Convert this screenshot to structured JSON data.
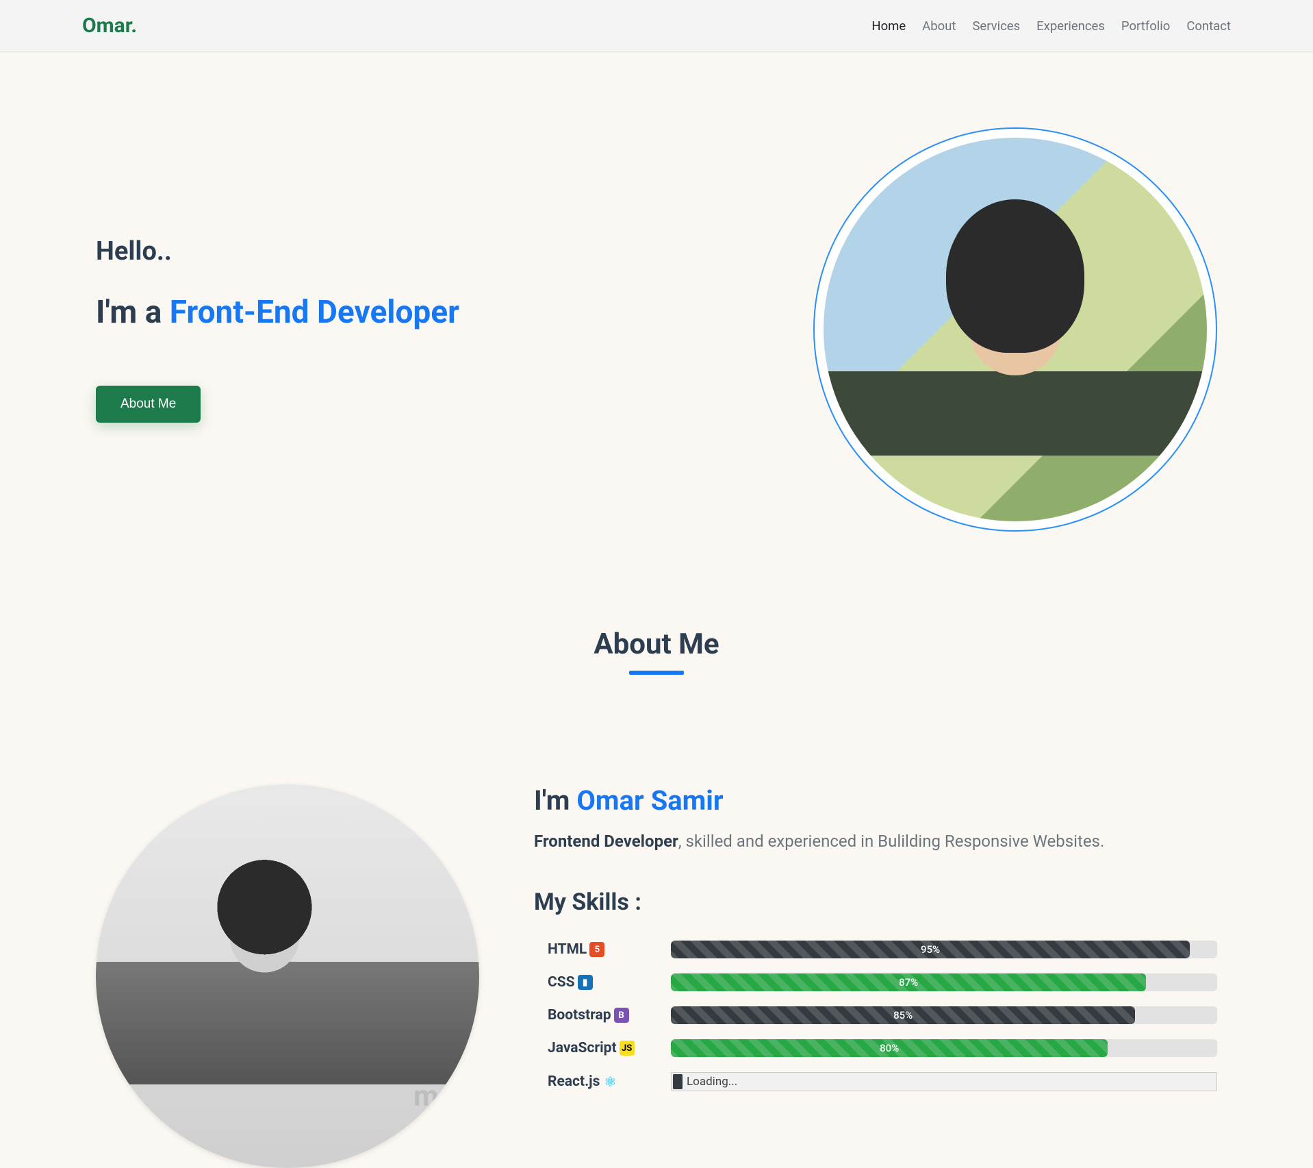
{
  "nav": {
    "logo": "Omar.",
    "links": [
      {
        "label": "Home",
        "active": true
      },
      {
        "label": "About",
        "active": false
      },
      {
        "label": "Services",
        "active": false
      },
      {
        "label": "Experiences",
        "active": false
      },
      {
        "label": "Portfolio",
        "active": false
      },
      {
        "label": "Contact",
        "active": false
      }
    ]
  },
  "hero": {
    "hello": "Hello..",
    "iam_prefix": "I'm a ",
    "iam_highlight": "Front-End Developer",
    "button": "About Me"
  },
  "about": {
    "section_title": "About Me",
    "intro_prefix": "I'm ",
    "intro_name": "Omar Samir",
    "role_bold": "Frontend Developer",
    "role_rest": ", skilled and experienced in Bulilding Responsive Websites.",
    "skills_title": "My Skills :",
    "watermark": "mostaq"
  },
  "skills": [
    {
      "name": "HTML",
      "icon": "html",
      "pct": 95,
      "pct_label": "95%",
      "color": "dark"
    },
    {
      "name": "CSS",
      "icon": "css",
      "pct": 87,
      "pct_label": "87%",
      "color": "green"
    },
    {
      "name": "Bootstrap",
      "icon": "bs",
      "pct": 85,
      "pct_label": "85%",
      "color": "dark"
    },
    {
      "name": "JavaScript",
      "icon": "js",
      "pct": 80,
      "pct_label": "80%",
      "color": "green"
    },
    {
      "name": "React.js",
      "icon": "react",
      "loading": true,
      "loading_label": "Loading..."
    }
  ]
}
